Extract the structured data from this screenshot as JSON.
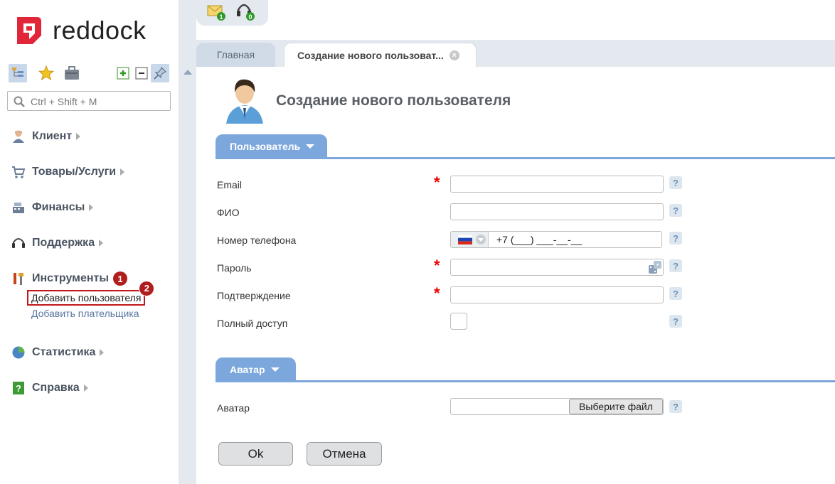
{
  "brand": {
    "name": "reddock",
    "accent": "#e2263a"
  },
  "sidebar": {
    "tools": [
      "tree-icon",
      "star-icon",
      "briefcase-icon",
      "expand-all-icon",
      "collapse-all-icon",
      "pin-icon"
    ],
    "search_placeholder": "Ctrl + Shift + M",
    "items": [
      {
        "label": "Клиент",
        "icon": "client-icon"
      },
      {
        "label": "Товары/Услуги",
        "icon": "cart-icon"
      },
      {
        "label": "Финансы",
        "icon": "cash-register-icon"
      },
      {
        "label": "Поддержка",
        "icon": "headset-icon"
      },
      {
        "label": "Инструменты",
        "icon": "tools-icon",
        "badge": "1",
        "children": [
          {
            "label": "Добавить пользователя",
            "badge": "2"
          },
          {
            "label": "Добавить плательщика"
          }
        ]
      },
      {
        "label": "Статистика",
        "icon": "pie-chart-icon"
      },
      {
        "label": "Справка",
        "icon": "help-book-icon"
      }
    ]
  },
  "topbar": {
    "mail_count": "1",
    "support_count": "0"
  },
  "tabs": {
    "home": "Главная",
    "current": "Создание нового пользоват..."
  },
  "page": {
    "title": "Создание нового пользователя",
    "section_user": "Пользователь",
    "section_avatar": "Аватар",
    "fields": {
      "email": "Email",
      "fio": "ФИО",
      "phone": "Номер телефона",
      "password": "Пароль",
      "confirm": "Подтверждение",
      "full_access": "Полный доступ",
      "avatar": "Аватар"
    },
    "required_mark": "*",
    "help_mark": "?",
    "phone_value": "+7 (___) ___-__-__",
    "file_button": "Выберите файл",
    "ok": "Ok",
    "cancel": "Отмена"
  }
}
